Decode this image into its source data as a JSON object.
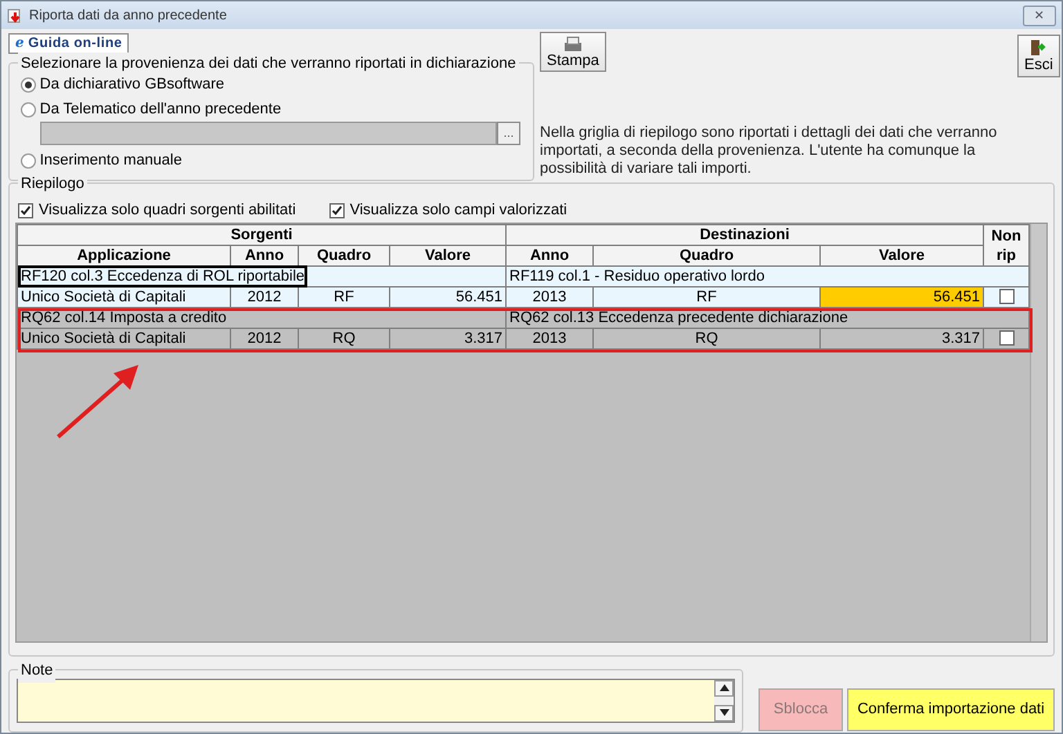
{
  "window": {
    "title": "Riporta dati da anno precedente",
    "close_label": "✕"
  },
  "help_button": {
    "icon": "e",
    "label": "Guida on-line"
  },
  "source_group": {
    "title": "Selezionare la provenienza dei dati che verranno riportati in dichiarazione",
    "options": [
      {
        "label": "Da dichiarativo GBsoftware",
        "selected": true
      },
      {
        "label": "Da Telematico dell'anno precedente",
        "selected": false,
        "browse_label": "..."
      },
      {
        "label": "Inserimento manuale",
        "selected": false
      }
    ]
  },
  "toolbar": [
    {
      "kind": "print",
      "label": "Stampa"
    },
    {
      "kind": "exit",
      "label": "Esci"
    }
  ],
  "description": "Nella griglia di riepilogo sono riportati i dettagli dei dati che verranno importati, a seconda della provenienza. L'utente ha comunque la possibilità di variare tali importi.",
  "summary": {
    "title": "Riepilogo",
    "filters": [
      {
        "label": "Visualizza solo quadri sorgenti abilitati",
        "checked": true
      },
      {
        "label": "Visualizza solo campi valorizzati",
        "checked": true
      }
    ],
    "groups": [
      {
        "label": "Sorgenti"
      },
      {
        "label": "Destinazioni"
      },
      {
        "label": "Non rip"
      }
    ],
    "columns": [
      "Applicazione",
      "Anno",
      "Quadro",
      "Valore",
      "Anno",
      "Quadro",
      "Valore"
    ],
    "records": [
      {
        "source_title": "RF120 col.3 Eccedenza di ROL riportabile",
        "dest_title": "RF119 col.1 - Residuo operativo lordo",
        "cells": [
          "Unico Società di Capitali",
          "2012",
          "RF",
          "56.451",
          "2013",
          "RF",
          "56.451"
        ],
        "non_rip": false,
        "selected": false,
        "focused": true,
        "value_edited": true,
        "outlined": false
      },
      {
        "source_title": "RQ62 col.14 Imposta a credito",
        "dest_title": "RQ62 col.13 Eccedenza precedente dichiarazione",
        "cells": [
          "Unico Società di Capitali",
          "2012",
          "RQ",
          "3.317",
          "2013",
          "RQ",
          "3.317"
        ],
        "non_rip": false,
        "selected": true,
        "focused": false,
        "value_edited": false,
        "outlined": true
      }
    ],
    "arrow_shown": true
  },
  "notes": {
    "title": "Note"
  },
  "actions": [
    {
      "label": "Sblocca",
      "kind": "unlock",
      "disabled": true
    },
    {
      "label": "Conferma importazione dati",
      "kind": "confirm",
      "disabled": false
    }
  ]
}
